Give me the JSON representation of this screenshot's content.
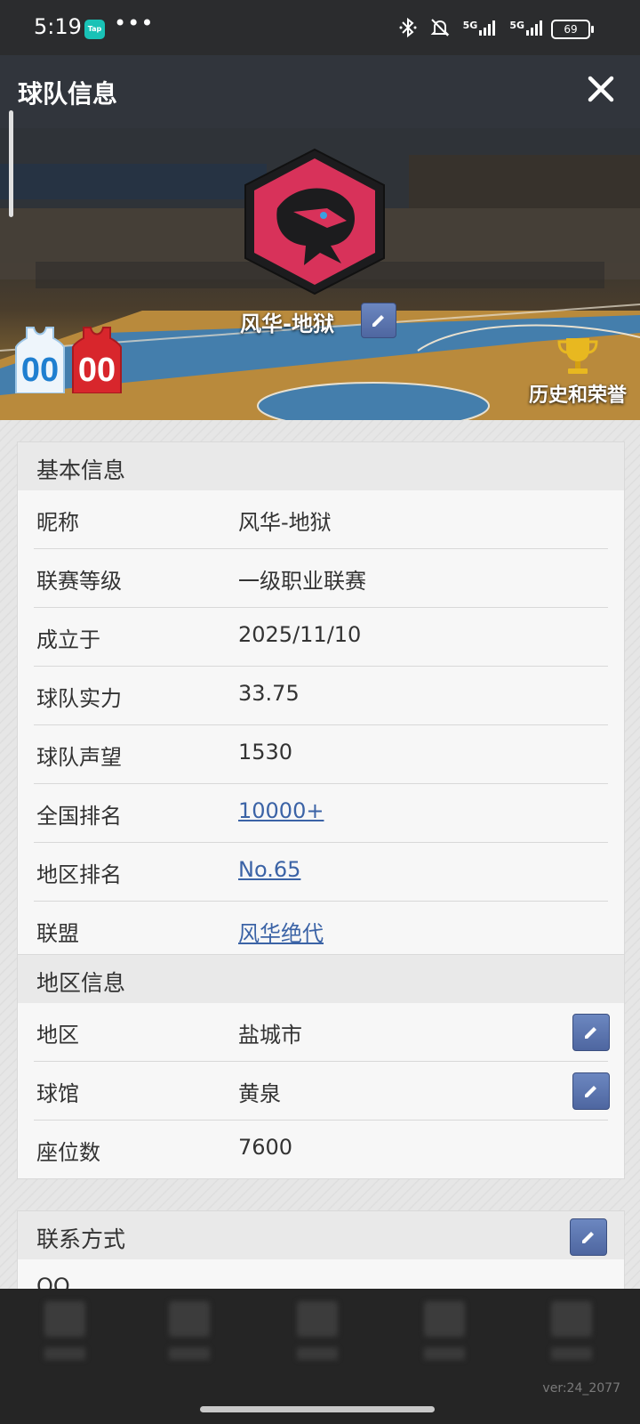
{
  "status_bar": {
    "time": "5:19",
    "app_icon_label": "Tap",
    "more": "•••",
    "network_1": "5G",
    "network_2": "5G",
    "battery": "69"
  },
  "header": {
    "title": "球队信息",
    "close_icon": "close-icon"
  },
  "banner": {
    "team_name": "风华-地狱",
    "home_jersey_number": "00",
    "away_jersey_number": "00",
    "honors_label": "历史和荣誉",
    "colors": {
      "logo": "#d8325a",
      "home_jersey": "#1f7fd0",
      "away_jersey": "#d8262c",
      "trophy": "#e8b820"
    }
  },
  "basic_info": {
    "title": "基本信息",
    "rows": [
      {
        "label": "昵称",
        "value": "风华-地狱",
        "link": false
      },
      {
        "label": "联赛等级",
        "value": "一级职业联赛",
        "link": false
      },
      {
        "label": "成立于",
        "value": "2025/11/10",
        "link": false
      },
      {
        "label": "球队实力",
        "value": "33.75",
        "link": false
      },
      {
        "label": "球队声望",
        "value": "1530",
        "link": false
      },
      {
        "label": "全国排名",
        "value": "10000+",
        "link": true
      },
      {
        "label": "地区排名",
        "value": "No.65",
        "link": true
      },
      {
        "label": "联盟",
        "value": "风华绝代",
        "link": true
      }
    ]
  },
  "region_info": {
    "title": "地区信息",
    "rows": [
      {
        "label": "地区",
        "value": "盐城市",
        "editable": true
      },
      {
        "label": "球馆",
        "value": "黄泉",
        "editable": true
      },
      {
        "label": "座位数",
        "value": "7600",
        "editable": false
      }
    ]
  },
  "contact_info": {
    "title": "联系方式",
    "partial_row_label": "QQ"
  },
  "footer": {
    "version": "ver:24_2077"
  },
  "accent_color": "#3b63a6"
}
